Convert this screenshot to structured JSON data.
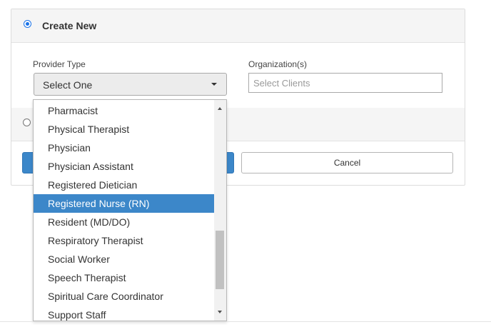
{
  "header": {
    "title": "Create New"
  },
  "form": {
    "provider_type_label": "Provider Type",
    "provider_type_value": "Select One",
    "organizations_label": "Organization(s)",
    "organizations_placeholder": "Select Clients"
  },
  "buttons": {
    "cancel_label": "Cancel"
  },
  "dropdown": {
    "options": [
      "Pharmacist",
      "Physical Therapist",
      "Physician",
      "Physician Assistant",
      "Registered Dietician",
      "Registered Nurse (RN)",
      "Resident (MD/DO)",
      "Respiratory Therapist",
      "Social Worker",
      "Speech Therapist",
      "Spiritual Care Coordinator",
      "Support Staff"
    ],
    "highlighted": "Registered Nurse (RN)"
  },
  "colors": {
    "accent": "#3c87c9",
    "header_bg": "#f5f5f5"
  }
}
